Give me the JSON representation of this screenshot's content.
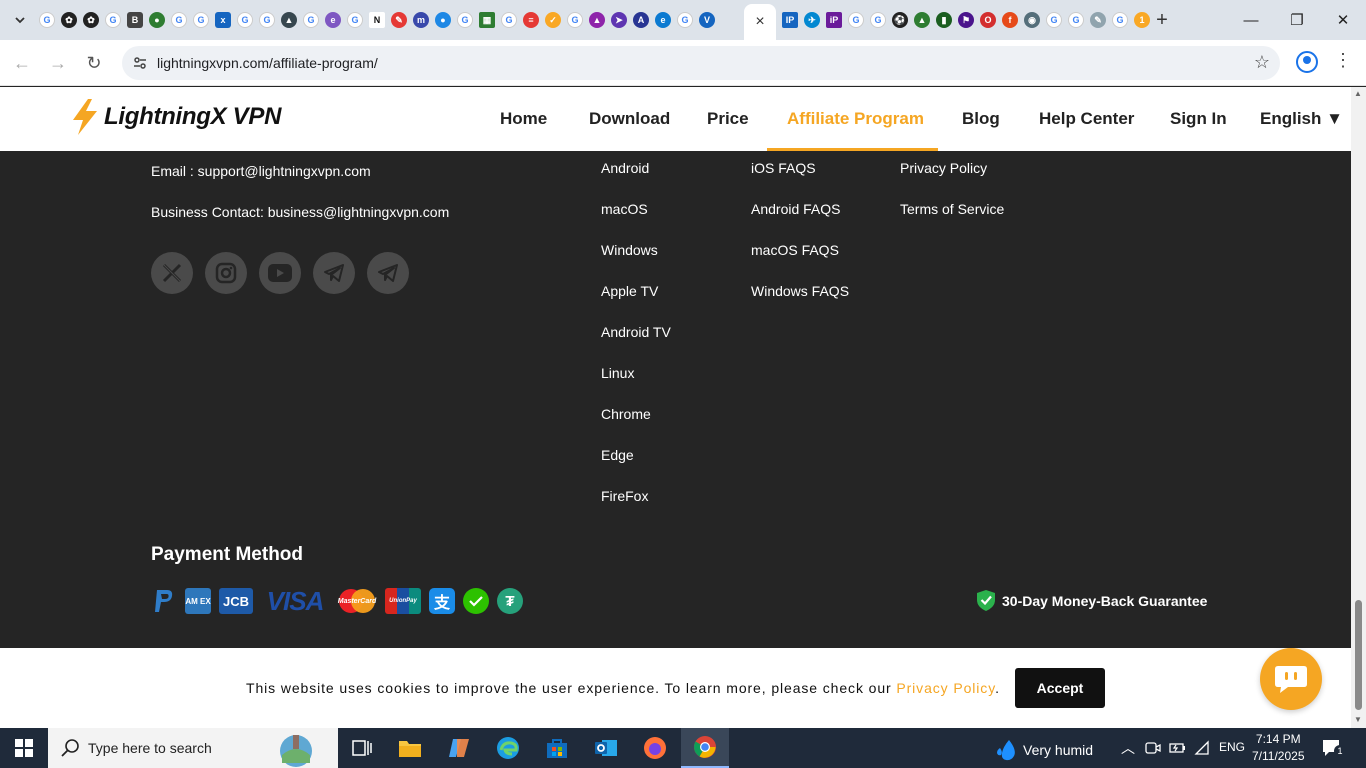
{
  "browser": {
    "active_tab_close": "×",
    "url": "lightningxvpn.com/affiliate-program/"
  },
  "header": {
    "logo_text": "LightningX VPN",
    "nav": {
      "home": "Home",
      "download": "Download",
      "price": "Price",
      "affiliate": "Affiliate Program",
      "blog": "Blog",
      "help": "Help Center",
      "signin": "Sign In",
      "language": "English ▼"
    },
    "accent_color": "#f5a623"
  },
  "footer": {
    "email": "Email : support@lightningxvpn.com",
    "business": "Business Contact: business@lightningxvpn.com",
    "downloads": [
      "Android",
      "macOS",
      "Windows",
      "Apple TV",
      "Android TV",
      "Linux",
      "Chrome",
      "Edge",
      "FireFox"
    ],
    "faqs": [
      "iOS FAQS",
      "Android FAQS",
      "macOS FAQS",
      "Windows FAQS"
    ],
    "legal": [
      "Privacy Policy",
      "Terms of Service"
    ],
    "payment_title": "Payment Method",
    "guarantee": "30-Day Money-Back Guarantee"
  },
  "payments": {
    "amex": "AM EX",
    "jcb": "JCB",
    "visa": "VISA",
    "mastercard": "MasterCard",
    "unionpay": "UnionPay"
  },
  "cookie": {
    "text": "This website uses cookies to improve the user experience. To learn more, please check our ",
    "link": "Privacy Policy",
    "end": ".",
    "accept": "Accept"
  },
  "taskbar": {
    "search_placeholder": "Type here to search",
    "weather": "Very humid",
    "lang": "ENG",
    "time": "7:14 PM",
    "date": "7/11/2025",
    "notif_count": "1"
  }
}
